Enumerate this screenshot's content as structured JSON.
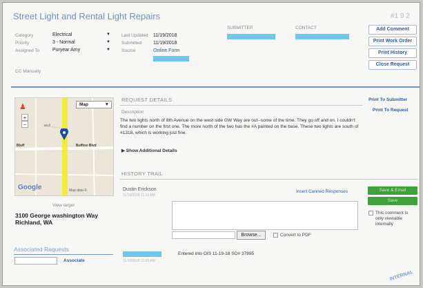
{
  "header": {
    "title": "Street Light and Rental Light Repairs",
    "request_number": "#1 9 2"
  },
  "fields": {
    "category_label": "Category",
    "category_value": "Electrical",
    "priority_label": "Priority",
    "priority_value": "3 - Normal",
    "assigned_label": "Assigned To",
    "assigned_value": "Puryear Amy",
    "last_updated_label": "Last Updated",
    "last_updated_value": "11/19/2018",
    "submitted_label": "Submitted",
    "submitted_value": "11/19/2018",
    "source_label": "Source",
    "source_value": "Online Form",
    "cc_label": "CC Manually",
    "submitter_label": "SUBMITTER",
    "contact_label": "CONTACT"
  },
  "actions": {
    "add_comment": "Add Comment",
    "print_work_order": "Print Work Order",
    "print_history": "Print History",
    "close_request": "Close Request",
    "print_to_submitter": "Print To Submitter",
    "print_to_request": "Print To Request"
  },
  "map": {
    "map_type": "Map",
    "footer_left": "Google",
    "footer_right": "Map data ©",
    "road_label_1": "Bluff",
    "road_label_2": "Bulfton Blvd",
    "road_label_3": "Bluff",
    "view_larger": "View larger",
    "address_line1": "3100 George washington Way",
    "address_line2": "Richland, WA"
  },
  "associated": {
    "title": "Associated Requests",
    "button": "Associate"
  },
  "details": {
    "section_title": "REQUEST DETAILS",
    "description_label": "Description",
    "description": "The two lights north of 8th Avenue on the west side GW Way are out--some of the time. They go off and on. I couldn't find a number on the first one. The more north of the two has the #A painted on the base. These two lights are south of #1318, which is working just fine.",
    "show_more": "▶ Show Additional Details"
  },
  "history": {
    "section_title": "HISTORY TRAIL",
    "commenter": "Dustin Erickson",
    "commenter_sub": "11/19/2018 11:13 AM",
    "insert_canned": "Insert Canned Responses",
    "save_and_email": "Save & Email",
    "save": "Save",
    "only_viewable": "This comment is only viewable internally",
    "browse": "Browse...",
    "convert_pdf": "Convert to PDF",
    "entry_text": "Entered into OIS 11-19-18  SO# 37895",
    "entry_sub": "11/19/2018 11:55 AM"
  },
  "stamp": "INTERNAL"
}
